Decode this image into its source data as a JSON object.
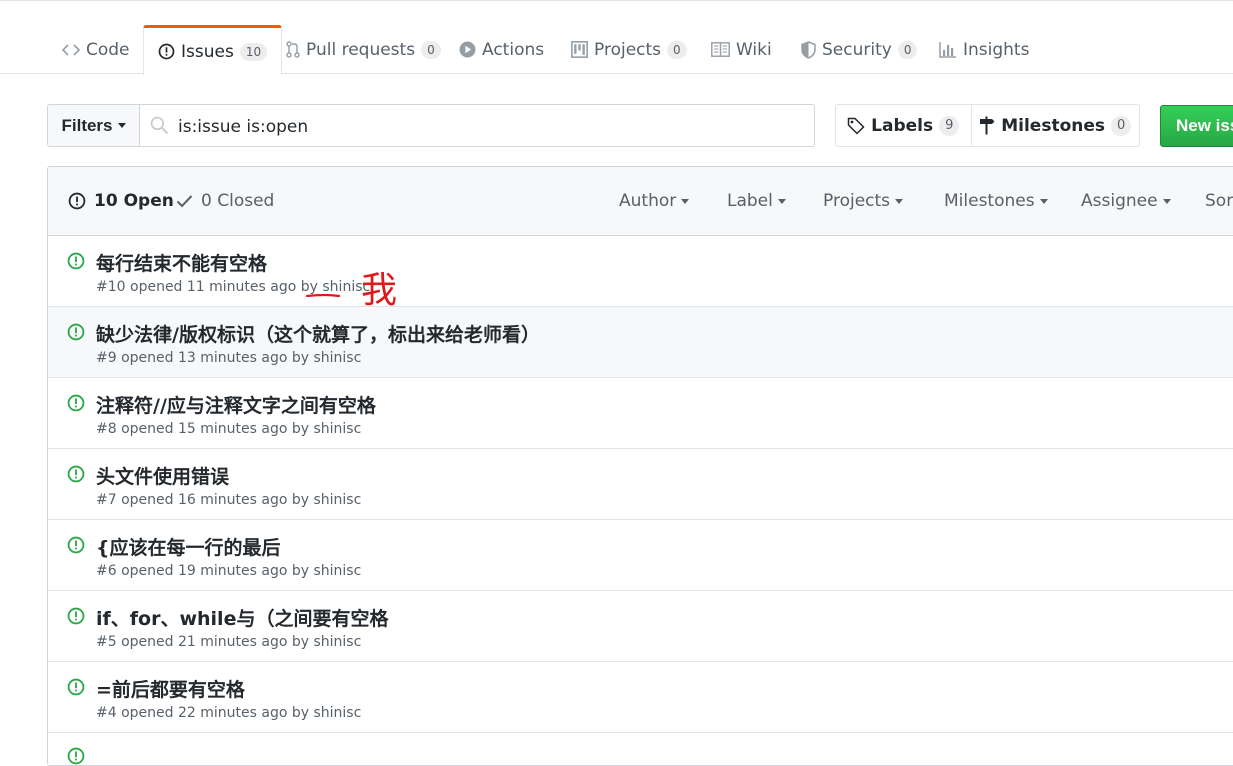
{
  "colors": {
    "accent_tab": "#e36209",
    "open_green": "#28a745",
    "new_issue_green": "#2ea44f",
    "annotation_red": "#e0191c"
  },
  "nav": {
    "tabs": [
      {
        "label": "Code",
        "icon": "code-icon",
        "count": null
      },
      {
        "label": "Issues",
        "icon": "issue-opened-icon",
        "count": "10",
        "selected": true
      },
      {
        "label": "Pull requests",
        "icon": "git-pull-request-icon",
        "count": "0"
      },
      {
        "label": "Actions",
        "icon": "play-icon",
        "count": null
      },
      {
        "label": "Projects",
        "icon": "project-icon",
        "count": "0"
      },
      {
        "label": "Wiki",
        "icon": "book-icon",
        "count": null
      },
      {
        "label": "Security",
        "icon": "shield-icon",
        "count": "0"
      },
      {
        "label": "Insights",
        "icon": "graph-icon",
        "count": null
      }
    ]
  },
  "subnav": {
    "filters_label": "Filters",
    "search_value": "is:issue is:open",
    "labels_label": "Labels",
    "labels_count": "9",
    "milestones_label": "Milestones",
    "milestones_count": "0",
    "new_issue_label": "New issue"
  },
  "header": {
    "open_label": "10 Open",
    "closed_label": "0 Closed",
    "menus": [
      "Author",
      "Label",
      "Projects",
      "Milestones",
      "Assignee",
      "Sort"
    ]
  },
  "issues": [
    {
      "title": "每行结束不能有空格",
      "number": "#10",
      "opened": "opened 11 minutes ago by",
      "author": "shinisc"
    },
    {
      "title": "缺少法律/版权标识（这个就算了，标出来给老师看）",
      "number": "#9",
      "opened": "opened 13 minutes ago by",
      "author": "shinisc"
    },
    {
      "title": "注释符//应与注释文字之间有空格",
      "number": "#8",
      "opened": "opened 15 minutes ago by",
      "author": "shinisc"
    },
    {
      "title": "头文件使用错误",
      "number": "#7",
      "opened": "opened 16 minutes ago by",
      "author": "shinisc"
    },
    {
      "title": "{应该在每一行的最后",
      "number": "#6",
      "opened": "opened 19 minutes ago by",
      "author": "shinisc"
    },
    {
      "title": "if、for、while与（之间要有空格",
      "number": "#5",
      "opened": "opened 21 minutes ago by",
      "author": "shinisc"
    },
    {
      "title": "=前后都要有空格",
      "number": "#4",
      "opened": "opened 22 minutes ago by",
      "author": "shinisc"
    },
    {
      "title": "",
      "number": "",
      "opened": "",
      "author": ""
    }
  ],
  "annotation": {
    "text": "我"
  }
}
